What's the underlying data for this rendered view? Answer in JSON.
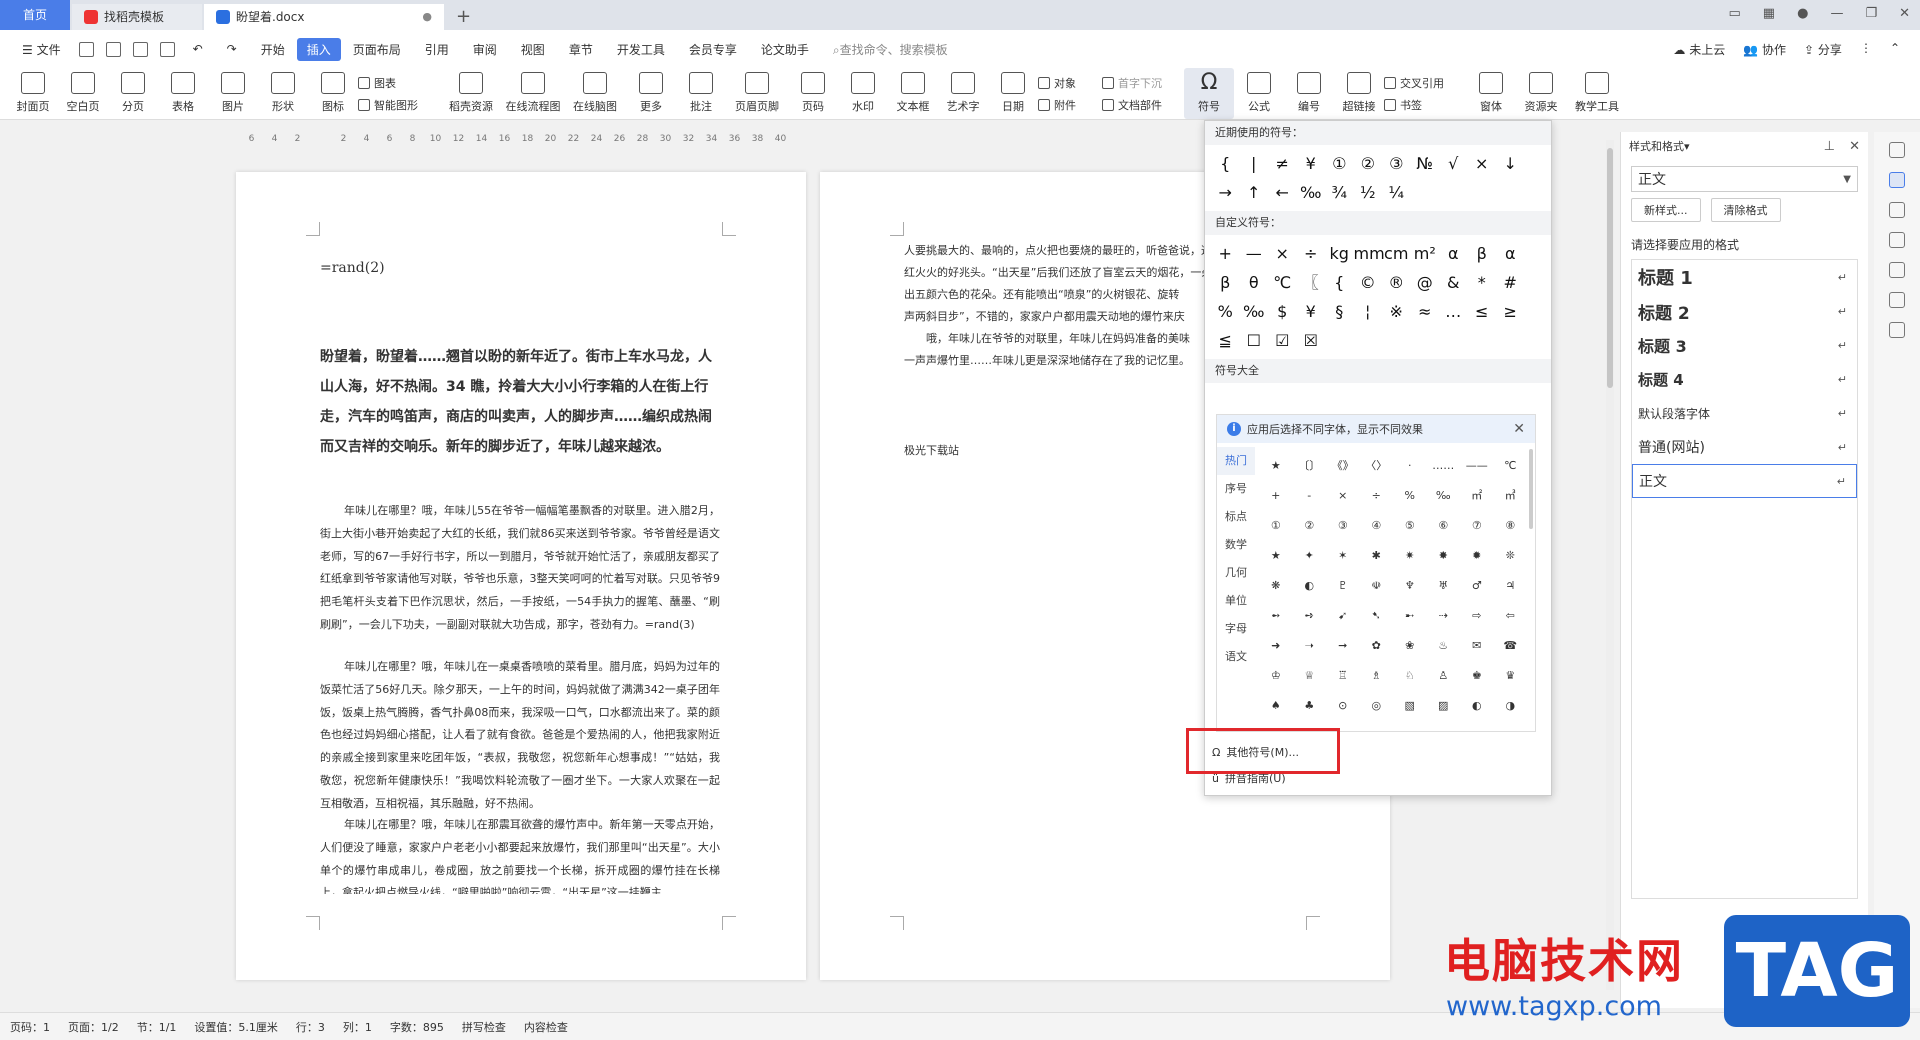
{
  "tabs": [
    {
      "label": "首页"
    },
    {
      "label": "找稻壳模板"
    },
    {
      "label": "盼望着.docx"
    }
  ],
  "menu": {
    "file": "文件",
    "items": [
      "开始",
      "插入",
      "页面布局",
      "引用",
      "审阅",
      "视图",
      "章节",
      "开发工具",
      "会员专享",
      "论文助手"
    ],
    "active": "插入",
    "search": "查找命令、搜索模板",
    "cloud": "未上云",
    "collab": "协作",
    "share": "分享"
  },
  "ribbon": [
    {
      "label": "封面页"
    },
    {
      "label": "空白页"
    },
    {
      "label": "分页"
    },
    {
      "label": "表格"
    },
    {
      "label": "图片"
    },
    {
      "label": "形状"
    },
    {
      "label": "图标"
    }
  ],
  "ribbon_small1": [
    "图表",
    "智能图形"
  ],
  "ribbon2": [
    {
      "label": "稻壳资源"
    },
    {
      "label": "在线流程图"
    },
    {
      "label": "在线脑图"
    },
    {
      "label": "更多"
    },
    {
      "label": "批注"
    },
    {
      "label": "页眉页脚"
    },
    {
      "label": "页码"
    },
    {
      "label": "水印"
    },
    {
      "label": "文本框"
    },
    {
      "label": "艺术字"
    },
    {
      "label": "日期"
    }
  ],
  "ribbon_small2": [
    "对象",
    "附件"
  ],
  "ribbon_small3": [
    "首字下沉",
    "文档部件"
  ],
  "ribbon3": [
    {
      "label": "符号"
    },
    {
      "label": "公式"
    },
    {
      "label": "编号"
    },
    {
      "label": "超链接"
    }
  ],
  "ribbon_small4": [
    "交叉引用",
    "书签"
  ],
  "ribbon4": [
    {
      "label": "窗体"
    },
    {
      "label": "资源夹"
    },
    {
      "label": "教学工具"
    }
  ],
  "ruler": [
    "6",
    "4",
    "2",
    "",
    "2",
    "4",
    "6",
    "8",
    "10",
    "12",
    "14",
    "16",
    "18",
    "20",
    "22",
    "24",
    "26",
    "28",
    "30",
    "32",
    "34",
    "36",
    "38",
    "40"
  ],
  "page1": {
    "formula": "=rand(2)",
    "bold": "盼望着，盼望着……翘首以盼的新年近了。街市上车水马龙，人山人海，好不热闹。34 瞧，拎着大大小小行李箱的人在街上行走，汽车的鸣笛声，商店的叫卖声，人的脚步声……编织成热闹而又吉祥的交响乐。新年的脚步近了，年味儿越来越浓。",
    "para1": "年味儿在哪里？哦，年味儿55在爷爷一幅幅笔墨飘香的对联里。进入腊2月，街上大街小巷开始卖起了大红的长纸，我们就86买来送到爷爷家。爷爷曾经是语文老师，写的67一手好行书字，所以一到腊月，爷爷就开始忙活了，亲戚朋友都买了红纸拿到爷爷家请他写对联，爷爷也乐意，3整天笑呵呵的忙着写对联。只见爷爷9把毛笔杆头支着下巴作沉思状，然后，一手按纸，一54手执力的握笔、蘸墨、“刷刷刷”，一会儿下功夫，一副副对联就大功告成，那字，苍劲有力。=rand(3)",
    "para2": "年味儿在哪里？哦，年味儿在一桌桌香喷喷的菜肴里。腊月底，妈妈为过年的饭菜忙活了56好几天。除夕那天，一上午的时间，妈妈就做了满满342一桌子团年饭，饭桌上热气腾腾，香气扑鼻08而来，我深吸一口气，口水都流出来了。菜的颜色也经过妈妈细心搭配，让人看了就有食欲。爸爸是个爱热闹的人，他把我家附近的亲戚全接到家里来吃团年饭，“表叔，我敬您，祝您新年心想事成！”“姑姑，我敬您，祝您新年健康快乐！”我喝饮料轮流敬了一圈才坐下。一大家人欢聚在一起互相敬酒，互相祝福，其乐融融，好不热闹。",
    "para3": "年味儿在哪里？哦，年味儿在那震耳欲聋的爆竹声中。新年第一天零点开始，人们便没了睡意，家家户户老老小小都要起来放爆竹，我们那里叫“出天星”。大小单个的爆竹串成串儿，卷成圈，放之前要找一个长梯，拆开成圈的爆竹挂在长梯上，拿起火把点燃导火线，“噼里啪啦”响彻云霄，“出天星”这一挂鞭主"
  },
  "page2": {
    "lines": [
      "人要挑最大的、最响的，点火把也要烧的最旺的，听爸爸说，这样新的一年才会",
      "红火火的好兆头。“出天星”后我们还放了盲室云天的烟花，一朵朵烟花",
      "出五颜六色的花朵。还有能喷出“喷泉”的火树银花、旋转",
      "声两斜目步”，不错的，家家户户都用震天动地的爆竹来庆",
      "　　哦，年味儿在爷爷的对联里，年味儿在妈妈准备的美味",
      "一声声爆竹里……年味儿更是深深地储存在了我的记忆里。"
    ],
    "source": "极光下载站"
  },
  "symbol_popup": {
    "recent_title": "近期使用的符号：",
    "recent": [
      "{",
      "|",
      "≠",
      "¥",
      "①",
      "②",
      "③",
      "№",
      "√",
      "×",
      "↓",
      "→",
      "↑",
      "←",
      "‰",
      "¾",
      "½",
      "¼"
    ],
    "custom_title": "自定义符号：",
    "custom": [
      "+",
      "—",
      "×",
      "÷",
      "kg",
      "mm",
      "cm",
      "m²",
      "α",
      "β",
      "α",
      "β",
      "θ",
      "℃",
      "〖",
      "{",
      "©",
      "®",
      "@",
      "&",
      "*",
      "#",
      "%",
      "‰",
      "$",
      "¥",
      "§",
      "¦",
      "※",
      "≈",
      "…",
      "≤",
      "≥",
      "≦",
      "☐",
      "☑",
      "☒"
    ],
    "all_title": "符号大全",
    "info": "应用后选择不同字体，显示不同效果",
    "categories": [
      "热门",
      "序号",
      "标点",
      "数学",
      "几何",
      "单位",
      "字母",
      "语文"
    ],
    "grid": [
      "★",
      "〔〕",
      "《》",
      "〈〉",
      "·",
      "……",
      "——",
      "℃",
      "+",
      "-",
      "×",
      "÷",
      "%",
      "‰",
      "㎡",
      "㎥",
      "①",
      "②",
      "③",
      "④",
      "⑤",
      "⑥",
      "⑦",
      "⑧",
      "★",
      "✦",
      "✶",
      "✱",
      "✷",
      "✸",
      "✹",
      "❊",
      "❋",
      "◐",
      "♇",
      "☫",
      "♆",
      "♅",
      "♂",
      "♃",
      "➻",
      "➺",
      "➹",
      "➷",
      "➸",
      "⇢",
      "⇨",
      "⇦",
      "➜",
      "➝",
      "➞",
      "✿",
      "❀",
      "♨",
      "✉",
      "☎",
      "♔",
      "♕",
      "♖",
      "♗",
      "♘",
      "♙",
      "♚",
      "♛",
      "♠",
      "♣",
      "⊙",
      "◎",
      "▧",
      "▨",
      "◐",
      "◑"
    ],
    "more": "其他符号(M)...",
    "pinyin": "拼音指南(U)"
  },
  "side_panel": {
    "title": "样式和格式",
    "current": "正文",
    "new_style": "新样式...",
    "clear": "清除格式",
    "prompt": "请选择要应用的格式",
    "styles": [
      {
        "name": "标题 1",
        "size": "bold 18px"
      },
      {
        "name": "标题 2",
        "size": "bold 17px"
      },
      {
        "name": "标题 3",
        "size": "bold 16px"
      },
      {
        "name": "标题 4",
        "size": "bold 15px"
      },
      {
        "name": "默认段落字体",
        "size": "12px"
      },
      {
        "name": "普通(网站)",
        "size": "14px"
      },
      {
        "name": "正文",
        "size": "14px"
      }
    ]
  },
  "status": [
    "页码：1",
    "页面：1/2",
    "节：1/1",
    "设置值：5.1厘米",
    "行：3",
    "列：1",
    "字数：895",
    "拼写检查",
    "内容检查"
  ],
  "watermark": {
    "text": "电脑技术网",
    "url": "www.tagxp.com",
    "tag": "TAG"
  },
  "colors": {
    "accent": "#4a7de8",
    "highlight": "#e1282c"
  }
}
